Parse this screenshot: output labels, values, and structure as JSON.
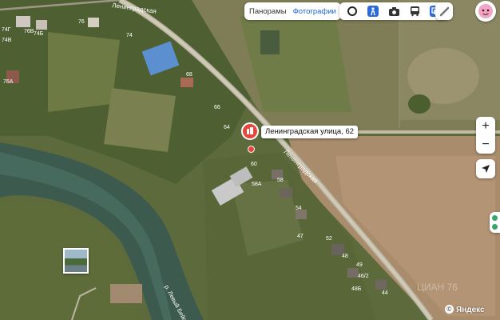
{
  "map": {
    "address_label": "Ленинградская улица, 62",
    "street_labels": [
      "Ленинградская",
      "Ленинградская"
    ],
    "river_label": "р. Левый Бейсуг",
    "house_numbers": [
      "74Г",
      "74Б",
      "74",
      "76",
      "74В",
      "68",
      "66",
      "64",
      "60",
      "58А",
      "58",
      "54",
      "52",
      "47",
      "49",
      "48",
      "46/2",
      "48Б",
      "44",
      "76А",
      "76В"
    ],
    "brand": "Яндекс",
    "watermark": "ЦИАН  76"
  },
  "toolbar": {
    "tabs": [
      {
        "label": "Панорамы",
        "active": false
      },
      {
        "label": "Фотографии",
        "active": true
      }
    ],
    "layers": [
      "traffic-layer-icon",
      "panorama-man-icon",
      "camera-icon",
      "bus-icon",
      "layers-icon"
    ],
    "ruler_icon": "ruler-icon",
    "profile_icon": "profile-avatar-icon"
  },
  "controls": {
    "zoom_in": "+",
    "zoom_out": "−",
    "locate_icon": "location-arrow-icon"
  },
  "colors": {
    "pin": "#e9453b",
    "active_tab": "#1e64d8",
    "accent_badge": "#3aa56a"
  }
}
